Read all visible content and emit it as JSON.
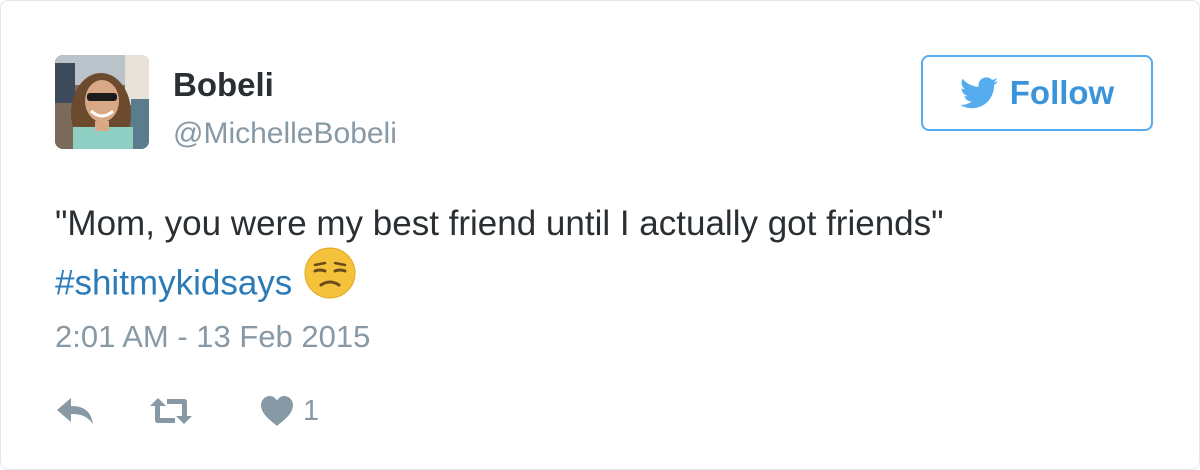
{
  "tweet": {
    "display_name": "Bobeli",
    "handle": "@MichelleBobeli",
    "follow_label": "Follow",
    "text": "\"Mom, you were my best friend until I actually got friends\"",
    "hashtag": "#shitmykidsays",
    "emoji": "unamused-face-emoji",
    "timestamp": "2:01 AM - 13 Feb 2015",
    "like_count": "1"
  },
  "icons": {
    "follow": "twitter-bird-icon",
    "reply": "reply-icon",
    "retweet": "retweet-icon",
    "like": "heart-icon"
  },
  "colors": {
    "accent": "#55acee",
    "link": "#2b7bb9",
    "muted": "#8899a6",
    "text": "#292f33",
    "border": "#e1e8ed"
  }
}
